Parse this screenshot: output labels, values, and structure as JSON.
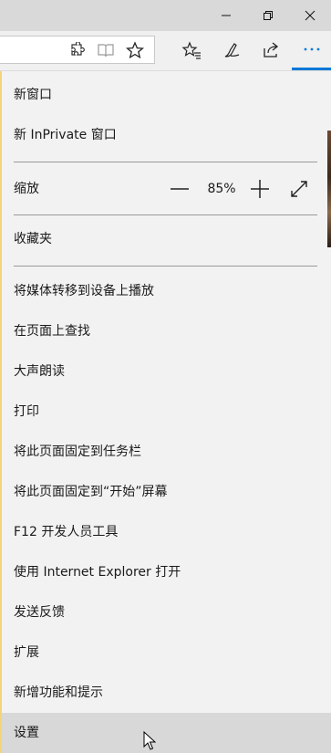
{
  "window": {
    "controls": [
      {
        "name": "minimize",
        "icon": "minimize-icon"
      },
      {
        "name": "restore",
        "icon": "restore-icon"
      },
      {
        "name": "close",
        "icon": "close-icon"
      }
    ]
  },
  "toolbar": {
    "address_icons": [
      "extension-icon",
      "reading-view-icon",
      "favorite-star-icon"
    ],
    "buttons": [
      "favorites-hub-icon",
      "web-note-icon",
      "share-icon",
      "more-icon"
    ],
    "accent_color": "#0078d7"
  },
  "menu": {
    "new_window": "新窗口",
    "new_inprivate": "新 InPrivate 窗口",
    "zoom_label": "缩放",
    "zoom_value": "85%",
    "favorites": "收藏夹",
    "items": [
      "将媒体转移到设备上播放",
      "在页面上查找",
      "大声朗读",
      "打印",
      "将此页面固定到任务栏",
      "将此页面固定到“开始”屏幕",
      "F12 开发人员工具",
      "使用 Internet Explorer 打开",
      "发送反馈",
      "扩展",
      "新增功能和提示",
      "设置"
    ]
  }
}
